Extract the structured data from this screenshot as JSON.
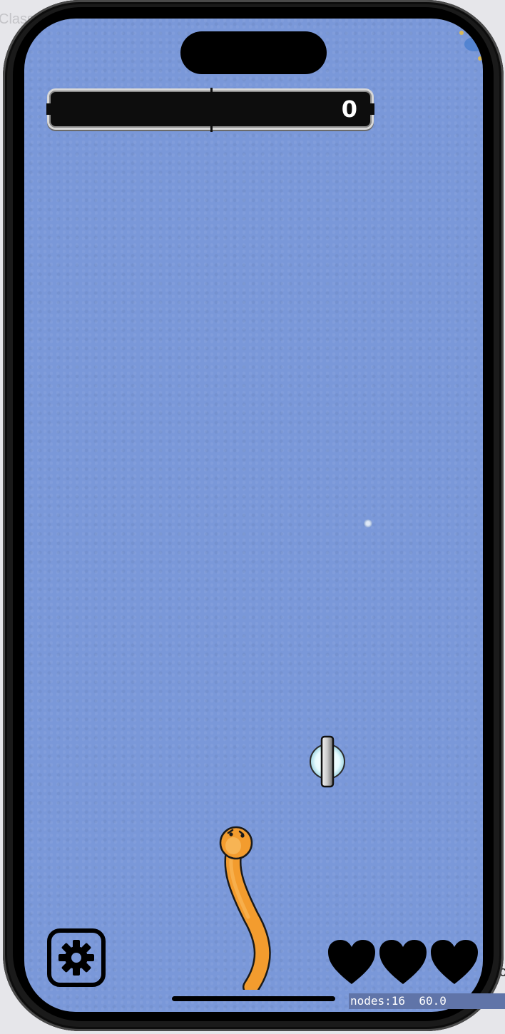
{
  "background": {
    "left_text": "Class",
    "right_text": "c"
  },
  "hud": {
    "score": "0"
  },
  "lives": {
    "count": 3,
    "icon": "heart-icon"
  },
  "settings": {
    "icon": "gear-icon"
  },
  "debug": {
    "nodes": "nodes:16",
    "fps": "60.0"
  },
  "colors": {
    "water": "#7a98d9",
    "snake": "#f39c2e",
    "hud_bg": "#0d0d0d"
  }
}
